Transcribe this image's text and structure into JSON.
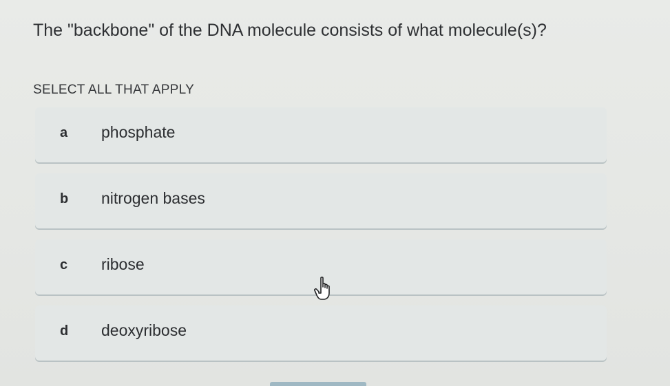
{
  "question": {
    "text": "The \"backbone\" of the DNA molecule consists of what molecule(s)?"
  },
  "instruction": "SELECT ALL THAT APPLY",
  "options": [
    {
      "letter": "a",
      "label": "phosphate"
    },
    {
      "letter": "b",
      "label": "nitrogen bases"
    },
    {
      "letter": "c",
      "label": "ribose"
    },
    {
      "letter": "d",
      "label": "deoxyribose"
    }
  ],
  "cursor": {
    "icon": "hand-pointer-icon"
  },
  "colors": {
    "background": "#e7e9e6",
    "option_background": "#e3e7e6",
    "option_underline": "#b9c2c4",
    "text": "#2b2d30",
    "bottom_bar": "#9fb8c3"
  }
}
